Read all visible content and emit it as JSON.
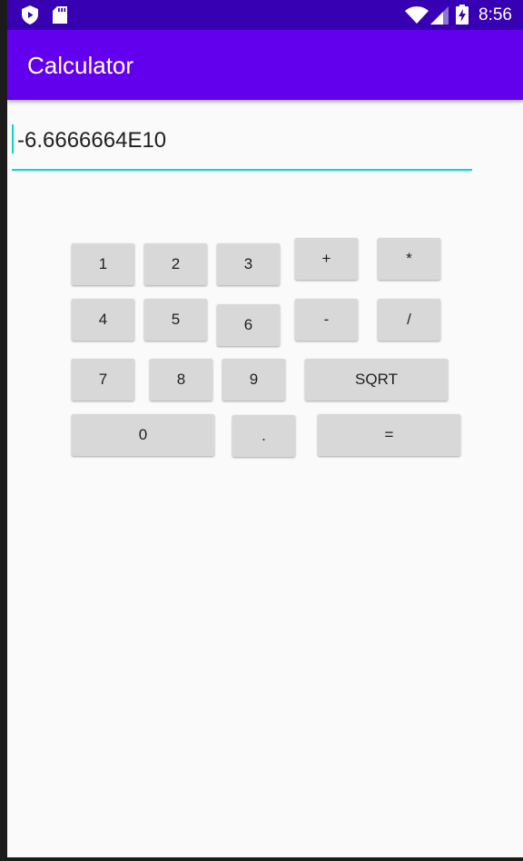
{
  "status_bar": {
    "time": "8:56",
    "left_icons": [
      "shield-icon",
      "sd-card-icon"
    ],
    "right_icons": [
      "wifi-icon",
      "signal-icon",
      "battery-charging-icon"
    ]
  },
  "app_bar": {
    "title": "Calculator"
  },
  "display": {
    "value": "-6.6666664E10"
  },
  "keys": {
    "k1": "1",
    "k2": "2",
    "k3": "3",
    "plus": "+",
    "multiply": "*",
    "k4": "4",
    "k5": "5",
    "k6": "6",
    "minus": "-",
    "divide": "/",
    "k7": "7",
    "k8": "8",
    "k9": "9",
    "sqrt": "SQRT",
    "k0": "0",
    "dot": ".",
    "equals": "="
  },
  "colors": {
    "status_bar": "#3700b3",
    "app_bar": "#6200ee",
    "accent": "#03dac5",
    "key_bg": "#d8d8d8",
    "background": "#fafafa"
  }
}
